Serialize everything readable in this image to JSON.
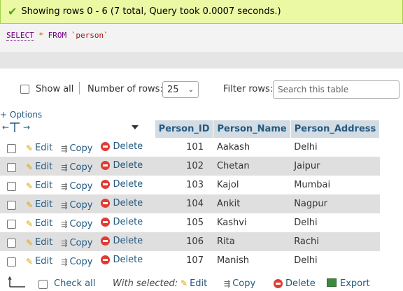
{
  "status": {
    "message": "Showing rows 0 - 6 (7 total, Query took 0.0007 seconds.)",
    "color": "#ebf8a4"
  },
  "sql": {
    "select": "SELECT",
    "star": "*",
    "from": "FROM",
    "table": "`person`"
  },
  "controls": {
    "show_all": "Show all",
    "number_of_rows_label": "Number of rows:",
    "rows_value": "25",
    "filter_label": "Filter rows:",
    "search_placeholder": "Search this table"
  },
  "options_link": "+ Options",
  "columns": [
    "Person_ID",
    "Person_Name",
    "Person_Address"
  ],
  "actions": {
    "edit": "Edit",
    "copy": "Copy",
    "delete": "Delete"
  },
  "rows": [
    {
      "id": "101",
      "name": "Aakash",
      "address": "Delhi"
    },
    {
      "id": "102",
      "name": "Chetan",
      "address": "Jaipur"
    },
    {
      "id": "103",
      "name": "Kajol",
      "address": "Mumbai"
    },
    {
      "id": "104",
      "name": "Ankit",
      "address": "Nagpur"
    },
    {
      "id": "105",
      "name": "Kashvi",
      "address": "Delhi"
    },
    {
      "id": "106",
      "name": "Rita",
      "address": "Rachi"
    },
    {
      "id": "107",
      "name": "Manish",
      "address": "Delhi"
    }
  ],
  "bottom": {
    "check_all": "Check all",
    "with_selected": "With selected:",
    "edit": "Edit",
    "copy": "Copy",
    "delete": "Delete",
    "export": "Export"
  },
  "colors": {
    "header_bg": "#d3dce3",
    "link": "#235a81",
    "even_row": "#dfdfdf"
  }
}
